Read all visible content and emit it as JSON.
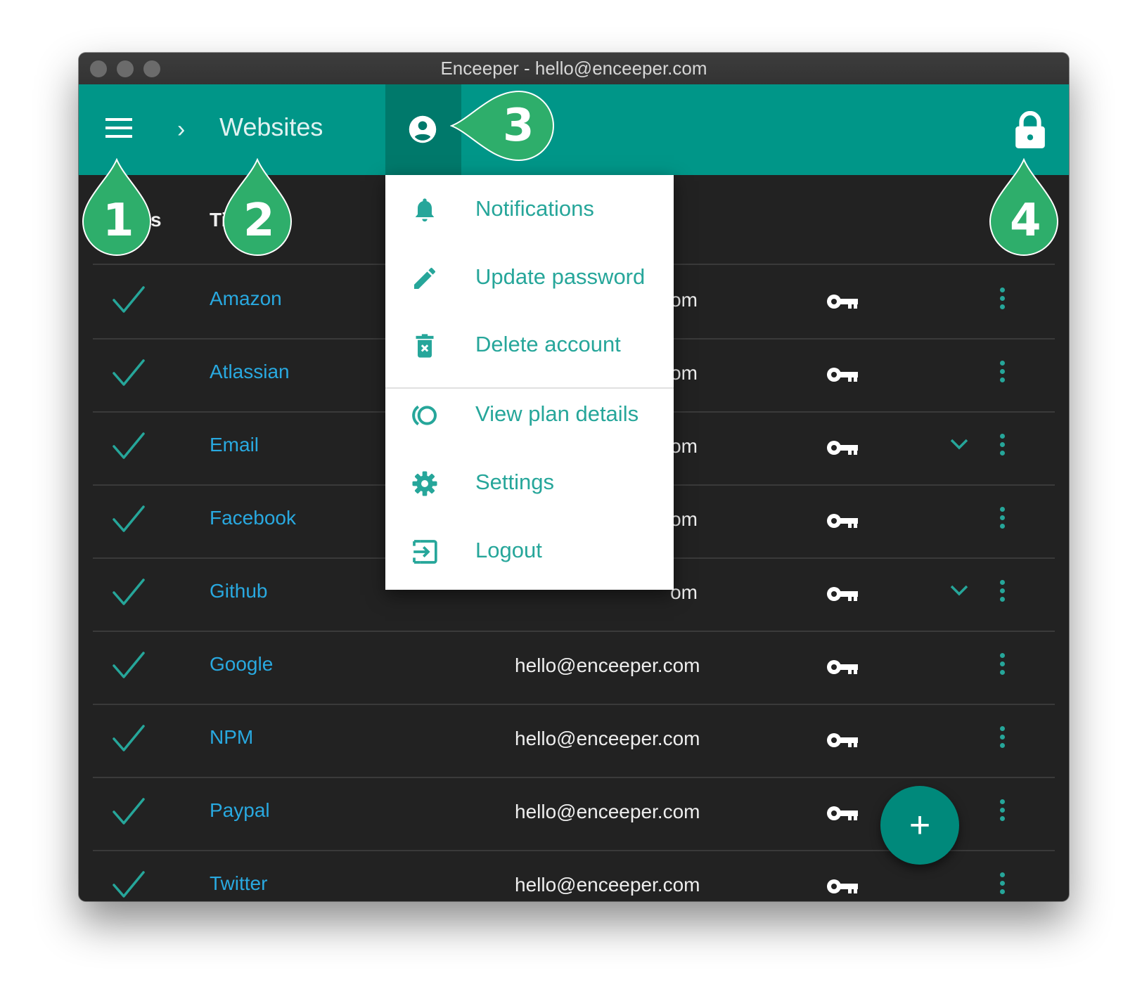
{
  "window": {
    "title": "Enceeper - hello@enceeper.com"
  },
  "appbar": {
    "chevron": "›",
    "breadcrumb": "Websites"
  },
  "table": {
    "header_partial": "s",
    "header_title": "Titl",
    "rows": [
      {
        "title": "Amazon",
        "email": "om",
        "expand": false
      },
      {
        "title": "Atlassian",
        "email": "om",
        "expand": false
      },
      {
        "title": "Email",
        "email": "om",
        "expand": true
      },
      {
        "title": "Facebook",
        "email": "om",
        "expand": false
      },
      {
        "title": "Github",
        "email": "om",
        "expand": true
      },
      {
        "title": "Google",
        "email": "hello@enceeper.com",
        "expand": false
      },
      {
        "title": "NPM",
        "email": "hello@enceeper.com",
        "expand": false
      },
      {
        "title": "Paypal",
        "email": "hello@enceeper.com",
        "expand": false
      },
      {
        "title": "Twitter",
        "email": "hello@enceeper.com",
        "expand": false
      }
    ]
  },
  "menu": {
    "items": [
      {
        "label": "Notifications",
        "icon": "bell-icon"
      },
      {
        "label": "Update password",
        "icon": "pencil-icon"
      },
      {
        "label": "Delete account",
        "icon": "trash-icon"
      },
      {
        "label": "View plan details",
        "icon": "plan-icon"
      },
      {
        "label": "Settings",
        "icon": "gear-icon"
      },
      {
        "label": "Logout",
        "icon": "logout-icon"
      }
    ]
  },
  "fab": {
    "label": "+"
  },
  "callouts": [
    "1",
    "2",
    "3",
    "4"
  ],
  "colors": {
    "accent": "#009688",
    "accent_dark": "#00796b",
    "link": "#29a9e0",
    "callout": "#2eae6b",
    "background": "#222222"
  }
}
